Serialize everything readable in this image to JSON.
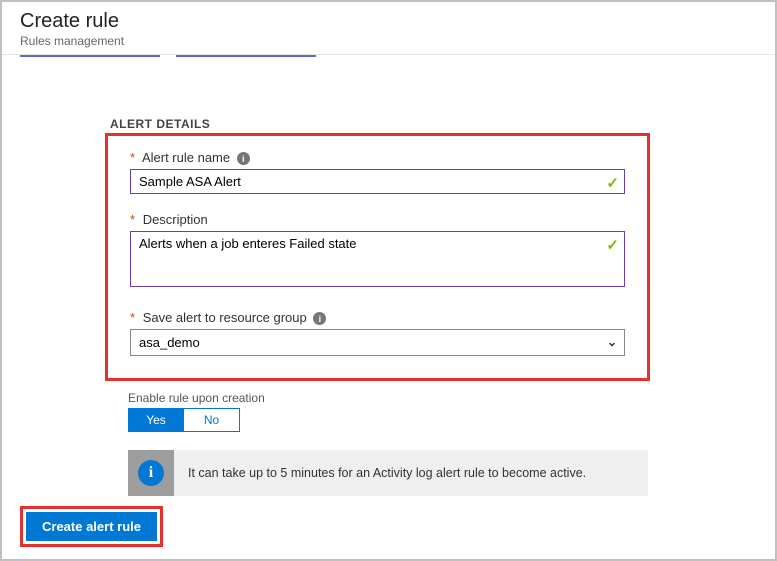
{
  "header": {
    "title": "Create rule",
    "subtitle": "Rules management"
  },
  "section": {
    "title": "ALERT DETAILS"
  },
  "fields": {
    "rule_name": {
      "label": "Alert rule name",
      "value": "Sample ASA Alert"
    },
    "description": {
      "label": "Description",
      "value": "Alerts when a job enteres Failed state"
    },
    "resource_group": {
      "label": "Save alert to resource group",
      "value": "asa_demo"
    }
  },
  "enable": {
    "label": "Enable rule upon creation",
    "yes": "Yes",
    "no": "No"
  },
  "notice": {
    "text": "It can take up to 5 minutes for an Activity log alert rule to become active."
  },
  "footer": {
    "create_label": "Create alert rule"
  }
}
